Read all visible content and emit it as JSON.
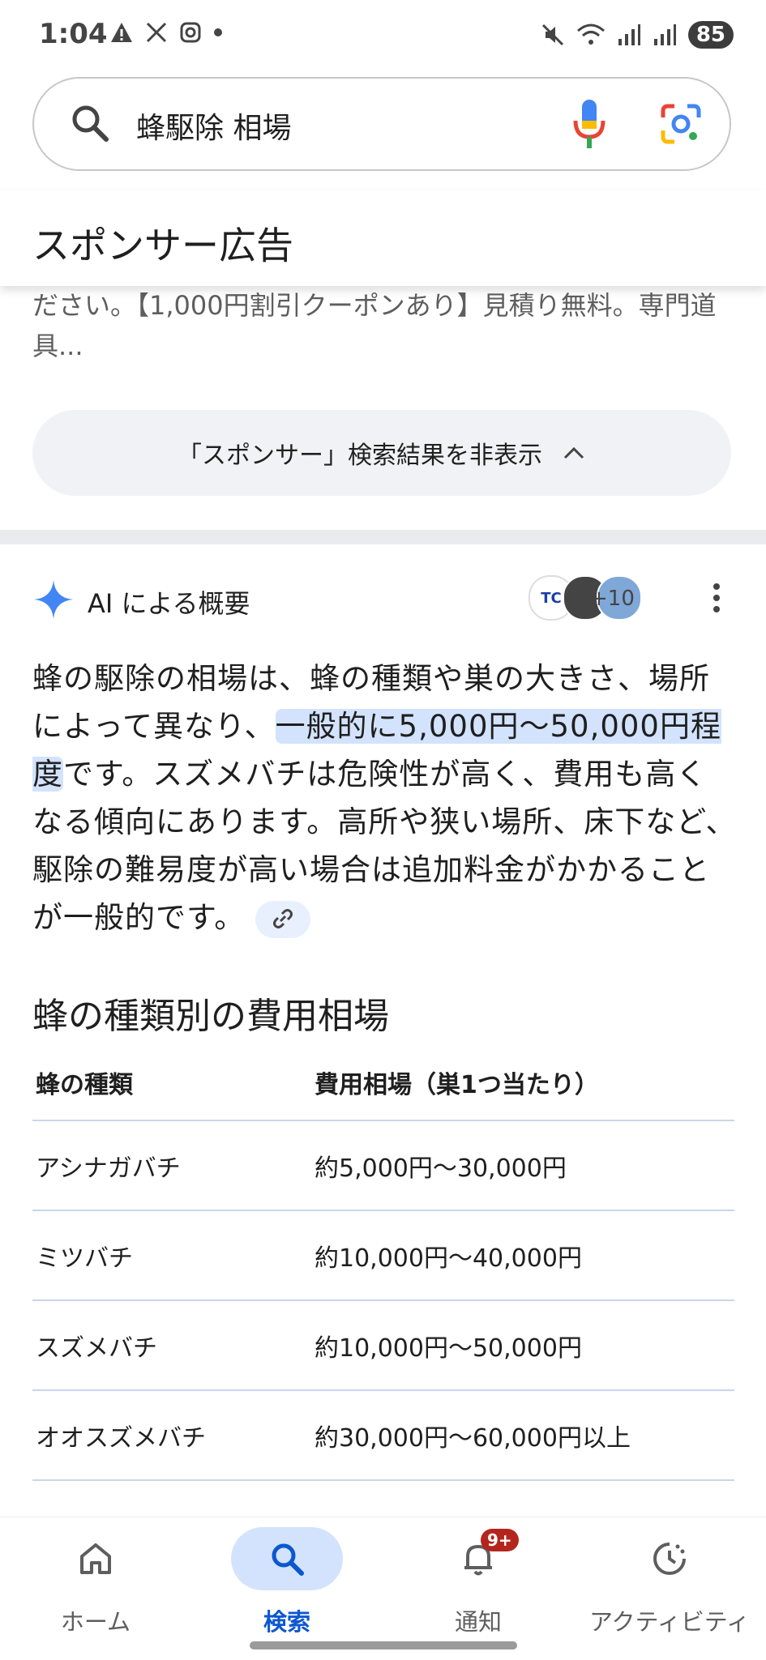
{
  "status_bar": {
    "time": "1:04",
    "battery": "85"
  },
  "search": {
    "query": "蜂駆除 相場"
  },
  "sponsored": {
    "title": "スポンサー広告",
    "snippet": "ださい。【1,000円割引クーポンあり】見積り無料。専門道具...",
    "hide_button": "「スポンサー」検索結果を非表示"
  },
  "ai_overview": {
    "title": "AI による概要",
    "sources_more": "+10",
    "source_1_abbr": "TC",
    "para_before": "蜂の駆除の相場は、蜂の種類や巣の大きさ、場所によって異なり、",
    "para_highlight": "一般的に5,000円〜50,000円程度",
    "para_after": "です。スズメバチは危険性が高く、費用も高くなる傾向にあります。高所や狭い場所、床下など、駆除の難易度が高い場合は追加料金がかかることが一般的です。"
  },
  "cost_table": {
    "title": "蜂の種類別の費用相場",
    "headers": [
      "蜂の種類",
      "費用相場（巣1つ当たり）"
    ],
    "rows": [
      [
        "アシナガバチ",
        "約5,000円〜30,000円"
      ],
      [
        "ミツバチ",
        "約10,000円〜40,000円"
      ],
      [
        "スズメバチ",
        "約10,000円〜50,000円"
      ],
      [
        "オオスズメバチ",
        "約30,000円〜60,000円以上"
      ]
    ]
  },
  "bottom_nav": {
    "items": [
      {
        "label": "ホーム",
        "icon": "home-icon"
      },
      {
        "label": "検索",
        "icon": "search-icon"
      },
      {
        "label": "通知",
        "icon": "bell-icon",
        "badge": "9+"
      },
      {
        "label": "アクティビティ",
        "icon": "activity-icon"
      }
    ],
    "active": "検索"
  },
  "colors": {
    "accent": "#0b57d0",
    "highlight": "#d3e3fd",
    "badge": "#b3261e"
  }
}
